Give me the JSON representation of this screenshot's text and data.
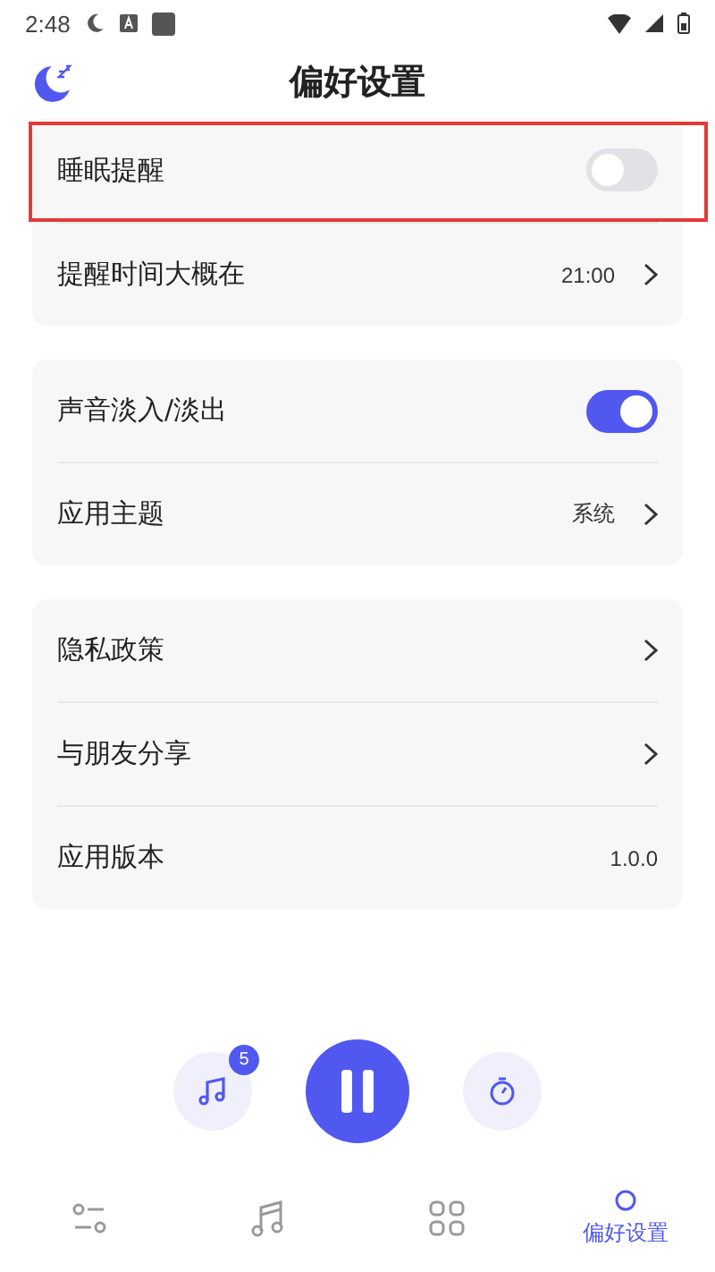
{
  "status_bar": {
    "time": "2:48"
  },
  "header": {
    "title": "偏好设置"
  },
  "groups": [
    {
      "rows": [
        {
          "kind": "toggle",
          "label": "睡眠提醒",
          "on": false,
          "highlighted": true
        },
        {
          "kind": "value",
          "label": "提醒时间大概在",
          "value": "21:00",
          "highlighted": false
        }
      ]
    },
    {
      "rows": [
        {
          "kind": "toggle",
          "label": "声音淡入/淡出",
          "on": true,
          "highlighted": false
        },
        {
          "kind": "value",
          "label": "应用主题",
          "value": "系统",
          "highlighted": false
        }
      ]
    },
    {
      "rows": [
        {
          "kind": "link",
          "label": "隐私政策",
          "highlighted": false
        },
        {
          "kind": "link",
          "label": "与朋友分享",
          "highlighted": false
        },
        {
          "kind": "text",
          "label": "应用版本",
          "value": "1.0.0",
          "highlighted": false
        }
      ]
    }
  ],
  "player": {
    "playlist_count": "5",
    "playing": true
  },
  "nav": [
    {
      "selected": false
    },
    {
      "selected": false
    },
    {
      "selected": false
    },
    {
      "label": "偏好设置",
      "selected": true
    }
  ]
}
